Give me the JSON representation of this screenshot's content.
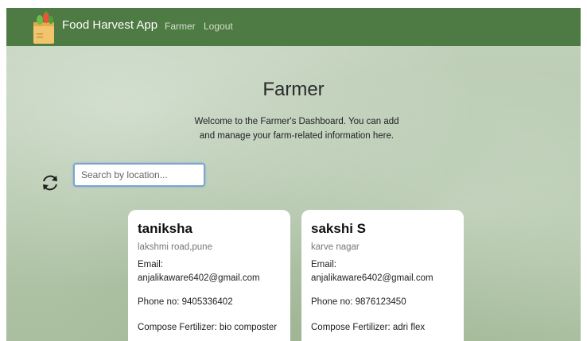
{
  "navbar": {
    "brand": "Food Harvest App",
    "links": [
      "Farmer",
      "Logout"
    ],
    "logo_icon": "grocery-bag-icon",
    "color": "#4e7a43"
  },
  "header": {
    "title": "Farmer",
    "subtitle": "Welcome to the Farmer's Dashboard. You can add and manage your farm-related information here."
  },
  "search": {
    "placeholder": "Search by location...",
    "value": "",
    "refresh_icon": "refresh-icon"
  },
  "farmers": [
    {
      "name": "taniksha",
      "location": "lakshmi road,pune",
      "email_label": "Email:",
      "email": "anjalikaware6402@gmail.com",
      "phone": "Phone no: 9405336402",
      "fertilizer": "Compose Fertilizer: bio composter"
    },
    {
      "name": "sakshi S",
      "location": "karve nagar",
      "email_label": "Email:",
      "email": "anjalikaware6402@gmail.com",
      "phone": "Phone no: 9876123450",
      "fertilizer": "Compose Fertilizer: adri flex"
    }
  ]
}
